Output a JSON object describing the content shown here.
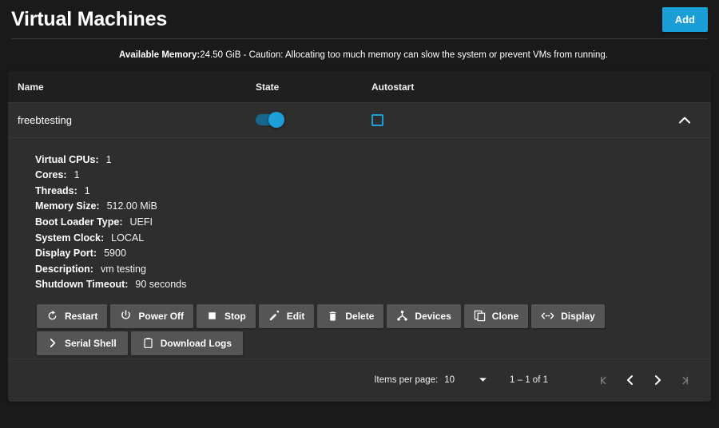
{
  "header": {
    "title": "Virtual Machines",
    "add_label": "Add"
  },
  "caution": {
    "label": "Available Memory:",
    "text": " 24.50 GiB - Caution: Allocating too much memory can slow the system or prevent VMs from running."
  },
  "table": {
    "columns": [
      "Name",
      "State",
      "Autostart"
    ],
    "row": {
      "name": "freebtesting",
      "state_on": true,
      "autostart_checked": false,
      "expand_icon": "chevron-up-icon"
    }
  },
  "details": [
    {
      "label": "Virtual CPUs:",
      "value": "1"
    },
    {
      "label": "Cores:",
      "value": "1"
    },
    {
      "label": "Threads:",
      "value": "1"
    },
    {
      "label": "Memory Size:",
      "value": "512.00 MiB"
    },
    {
      "label": "Boot Loader Type:",
      "value": "UEFI"
    },
    {
      "label": "System Clock:",
      "value": "LOCAL"
    },
    {
      "label": "Display Port:",
      "value": "5900"
    },
    {
      "label": "Description:",
      "value": "vm testing"
    },
    {
      "label": "Shutdown Timeout:",
      "value": "90 seconds"
    }
  ],
  "actions_row1": [
    {
      "label": "Restart",
      "icon": "restart-icon"
    },
    {
      "label": "Power Off",
      "icon": "power-icon"
    },
    {
      "label": "Stop",
      "icon": "stop-icon"
    },
    {
      "label": "Edit",
      "icon": "pencil-icon"
    },
    {
      "label": "Delete",
      "icon": "trash-icon"
    },
    {
      "label": "Devices",
      "icon": "devices-hub-icon"
    },
    {
      "label": "Clone",
      "icon": "clone-icon"
    },
    {
      "label": "Display",
      "icon": "display-arrows-icon"
    }
  ],
  "actions_row2": [
    {
      "label": "Serial Shell",
      "icon": "chevron-right-icon"
    },
    {
      "label": "Download Logs",
      "icon": "clipboard-icon"
    }
  ],
  "pager": {
    "items_per_page_label": "Items per page:",
    "items_per_page_value": "10",
    "range": "1 – 1 of 1",
    "first_icon": "first-page-icon",
    "prev_icon": "prev-page-icon",
    "next_icon": "next-page-icon",
    "last_icon": "last-page-icon"
  },
  "colors": {
    "accent": "#1a9ed8",
    "toggle_track": "#17678d",
    "toggle_knob": "#1e9fd8",
    "page_bg": "#1a1a1a",
    "card_bg": "#2e2e2e",
    "table_head_bg": "#1f1f1f",
    "button_bg": "#555555"
  }
}
